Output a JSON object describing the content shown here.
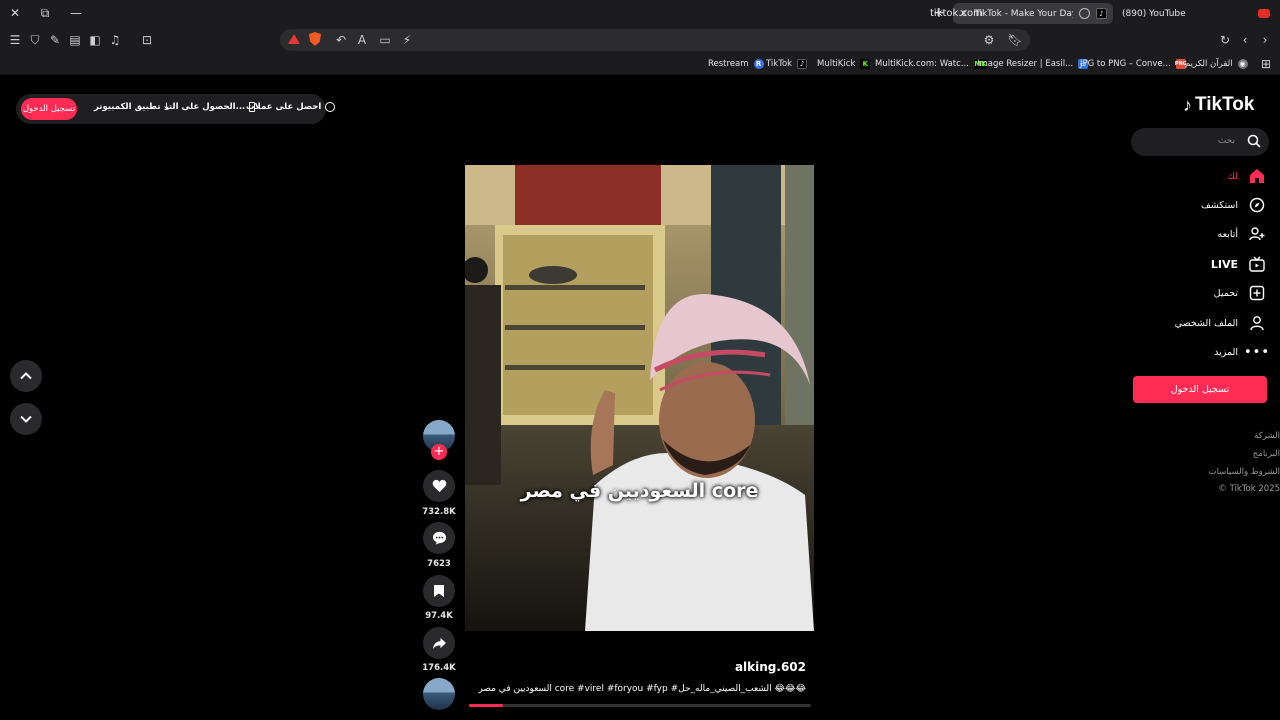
{
  "browser": {
    "tabs": [
      {
        "label": "TikTok - Make Your Day",
        "active": true
      },
      {
        "label": "(890) YouTube",
        "active": false
      }
    ],
    "url": "tiktok.com",
    "bookmarks": [
      {
        "label": "Restream",
        "icon": "R",
        "color": "#3b6ff5"
      },
      {
        "label": "TikTok",
        "icon": "♪",
        "color": "#000000"
      },
      {
        "label": "MultiKick",
        "icon": "K",
        "color": "#53fc18"
      },
      {
        "label": "MultiKick.com: Watc...",
        "icon": "MK",
        "color": "#53fc18"
      },
      {
        "label": "Image Resizer | Easil...",
        "icon": "▭",
        "color": "#2f6ee0"
      },
      {
        "label": "JPG to PNG – Conve...",
        "icon": "PNG",
        "color": "#e04a3a"
      },
      {
        "label": "القرآن الكريم",
        "icon": "◉",
        "color": "#888888"
      }
    ]
  },
  "top_pill": {
    "login": "تسجيل الدخول",
    "desktop_app": "تطبيق الكمبيوتر",
    "get_app": "الحصول على التـ...",
    "get_coins": "احصل على عملات"
  },
  "logo": "TikTok",
  "search": {
    "placeholder": "بحث"
  },
  "nav": [
    {
      "key": "home",
      "label": "لك",
      "icon": "home-icon"
    },
    {
      "key": "explore",
      "label": "استكشف",
      "icon": "compass-icon"
    },
    {
      "key": "following",
      "label": "أتابعه",
      "icon": "following-icon"
    },
    {
      "key": "live",
      "label": "LIVE",
      "icon": "live-icon"
    },
    {
      "key": "upload",
      "label": "تحميل",
      "icon": "upload-icon"
    },
    {
      "key": "profile",
      "label": "الملف الشخصي",
      "icon": "profile-icon"
    },
    {
      "key": "more",
      "label": "المزيد",
      "icon": "more-icon"
    }
  ],
  "side_login": "تسجيل الدخول",
  "footer": [
    "الشركة",
    "البرنامج",
    "الشروط والسياسات",
    "© TikTok 2025"
  ],
  "video": {
    "caption": "السعوديين في مصر core",
    "username": "alking.602",
    "description": "السعوديين في مصر core #virel #foryou #fyp #الشعب_الصيني_ماله_حل 😂😂😂",
    "progress": 0.1
  },
  "actions": {
    "likes": "732.8K",
    "comments": "7623",
    "saves": "97.4K",
    "shares": "176.4K"
  },
  "colors": {
    "accent": "#fe2c55",
    "background": "#000000",
    "button_bg": "#2a2a2c"
  }
}
